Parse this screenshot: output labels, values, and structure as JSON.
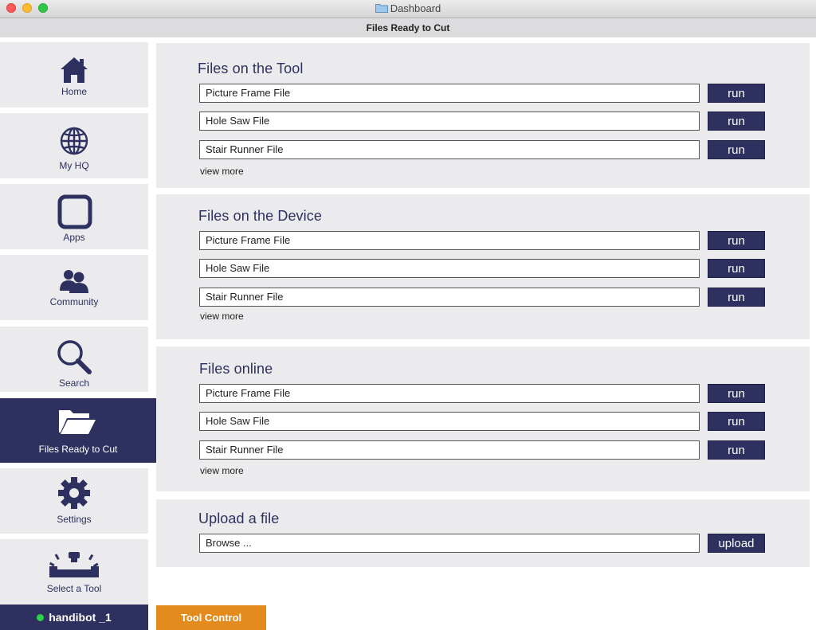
{
  "window": {
    "title": "Dashboard"
  },
  "header": {
    "title": "Files Ready to Cut"
  },
  "sidebar": {
    "items": [
      {
        "label": "Home",
        "icon": "home-icon"
      },
      {
        "label": "My HQ",
        "icon": "globe-icon"
      },
      {
        "label": "Apps",
        "icon": "apps-icon"
      },
      {
        "label": "Community",
        "icon": "community-icon"
      },
      {
        "label": "Search",
        "icon": "search-icon"
      },
      {
        "label": "Files Ready to Cut",
        "icon": "folder-open-icon",
        "active": true
      },
      {
        "label": "Settings",
        "icon": "gear-icon"
      },
      {
        "label": "Select a Tool",
        "icon": "tool-icon"
      }
    ],
    "status": {
      "label": "handibot _1",
      "color": "#2bd14a"
    }
  },
  "sections": [
    {
      "title": "Files on the Tool",
      "files": [
        "Picture Frame File",
        "Hole Saw File",
        "Stair Runner File"
      ],
      "action_label": "run",
      "more_label": "view more"
    },
    {
      "title": "Files on the Device",
      "files": [
        "Picture Frame File",
        "Hole Saw File",
        "Stair Runner File"
      ],
      "action_label": "run",
      "more_label": "view more"
    },
    {
      "title": "Files online",
      "files": [
        "Picture Frame File",
        "Hole Saw File",
        "Stair Runner File"
      ],
      "action_label": "run",
      "more_label": "view more"
    }
  ],
  "upload": {
    "title": "Upload a file",
    "browse_value": "Browse ...",
    "button_label": "upload"
  },
  "footer": {
    "tool_control_label": "Tool Control"
  },
  "colors": {
    "accent": "#2e3160",
    "orange": "#e38b1d",
    "panel": "#ebeaec"
  }
}
